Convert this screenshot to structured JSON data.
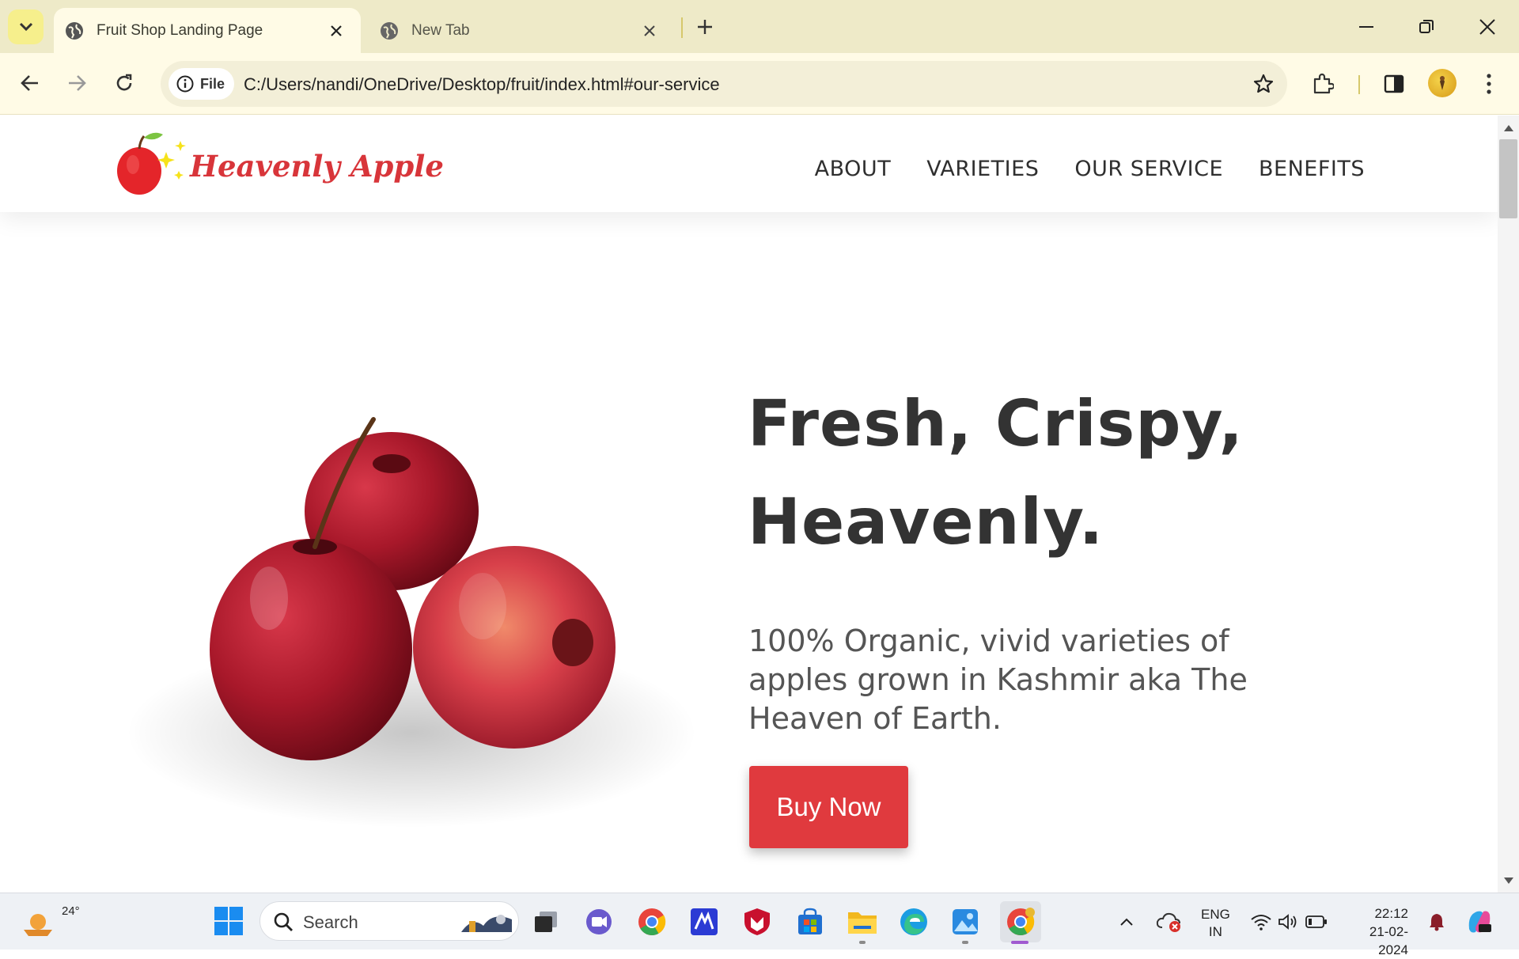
{
  "browser": {
    "tabs": [
      {
        "title": "Fruit Shop Landing Page",
        "active": true
      },
      {
        "title": "New Tab",
        "active": false
      }
    ],
    "address": {
      "chip_label": "File",
      "url": "C:/Users/nandi/OneDrive/Desktop/fruit/index.html#our-service"
    }
  },
  "page": {
    "brand": "Heavenly Apple",
    "nav": [
      "ABOUT",
      "VARIETIES",
      "OUR SERVICE",
      "BENEFITS"
    ],
    "hero": {
      "title_line1": "Fresh, Crispy,",
      "title_line2": "Heavenly.",
      "subtitle": "100% Organic, vivid varieties of apples grown in Kashmir aka The Heaven of Earth.",
      "cta": "Buy Now"
    }
  },
  "taskbar": {
    "weather_temp": "24°",
    "search_label": "Search",
    "language_line1": "ENG",
    "language_line2": "IN",
    "time": "22:12",
    "date": "21-02-2024"
  },
  "colors": {
    "accent_red": "#e03a3e",
    "tab_strip": "#eeeac8",
    "toolbar": "#fffbe6"
  }
}
